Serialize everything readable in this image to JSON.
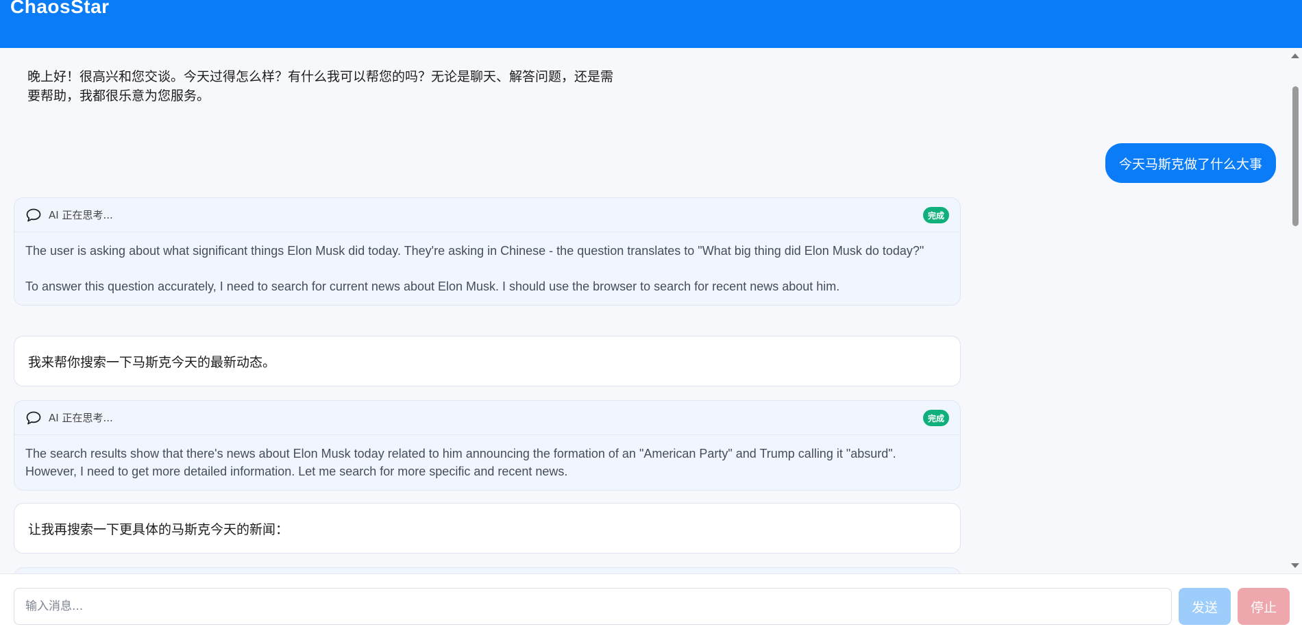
{
  "app": {
    "title": "ChaosStar"
  },
  "messages": {
    "greeting": "晚上好！很高兴和您交谈。今天过得怎么样？有什么我可以帮您的吗？无论是聊天、解答问题，还是需要帮助，我都很乐意为您服务。",
    "user_query": "今天马斯克做了什么大事",
    "thinking_1": {
      "label": "AI 正在思考...",
      "status": "完成",
      "paragraph_1": "The user is asking about what significant things Elon Musk did today. They're asking in Chinese - the question translates to \"What big thing did Elon Musk do today?\"",
      "paragraph_2": "To answer this question accurately, I need to search for current news about Elon Musk. I should use the browser to search for recent news about him."
    },
    "reply_1": "我来帮你搜索一下马斯克今天的最新动态。",
    "thinking_2": {
      "label": "AI 正在思考...",
      "status": "完成",
      "paragraph_1": "The search results show that there's news about Elon Musk today related to him announcing the formation of an \"American Party\" and Trump calling it \"absurd\". However, I need to get more detailed information. Let me search for more specific and recent news."
    },
    "reply_2": "让我再搜索一下更具体的马斯克今天的新闻："
  },
  "input": {
    "placeholder": "输入消息...",
    "value": "",
    "send_label": "发送",
    "stop_label": "停止"
  },
  "colors": {
    "header": "#0a7cf8",
    "user_bubble": "#0a7cf8",
    "done_badge": "#10b07c",
    "send_disabled": "#9ccdfb",
    "stop_disabled": "#eea7ad"
  },
  "icons": {
    "thinking": "chat-bubble-icon",
    "scroll_up": "scroll-up-arrow-icon",
    "scroll_down": "scroll-down-arrow-icon"
  }
}
